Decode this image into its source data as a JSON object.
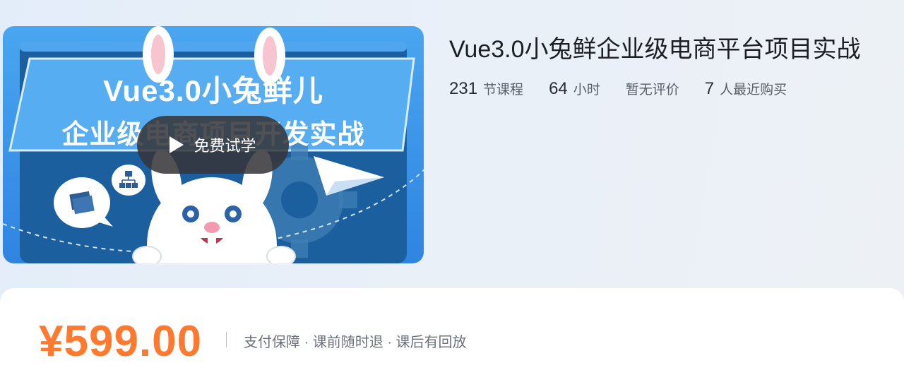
{
  "cover": {
    "title_line1": "Vue3.0小兔鲜儿",
    "title_line2": "企业级电商项目开发实战",
    "trial_label": "免费试学"
  },
  "course": {
    "title": "Vue3.0小兔鲜企业级电商平台项目实战",
    "stats": {
      "lessons_num": "231",
      "lessons_unit": "节课程",
      "hours_num": "64",
      "hours_unit": "小时",
      "rating_text": "暂无评价",
      "buyers_num": "7",
      "buyers_unit": "人最近购买"
    }
  },
  "pricing": {
    "price": "¥599.00",
    "guarantee": "支付保障 · 课前随时退 · 课后有回放"
  },
  "colors": {
    "price": "#ff7a2f",
    "cover_blue": "#3b8ee8",
    "cover_dark_blue": "#1a5d9e"
  },
  "icons": {
    "play": "play-icon",
    "network": "sitemap-icon",
    "layers": "layers-icon",
    "gear": "gear-icon",
    "plane": "paper-plane-icon",
    "mascot": "rabbit-mascot"
  }
}
